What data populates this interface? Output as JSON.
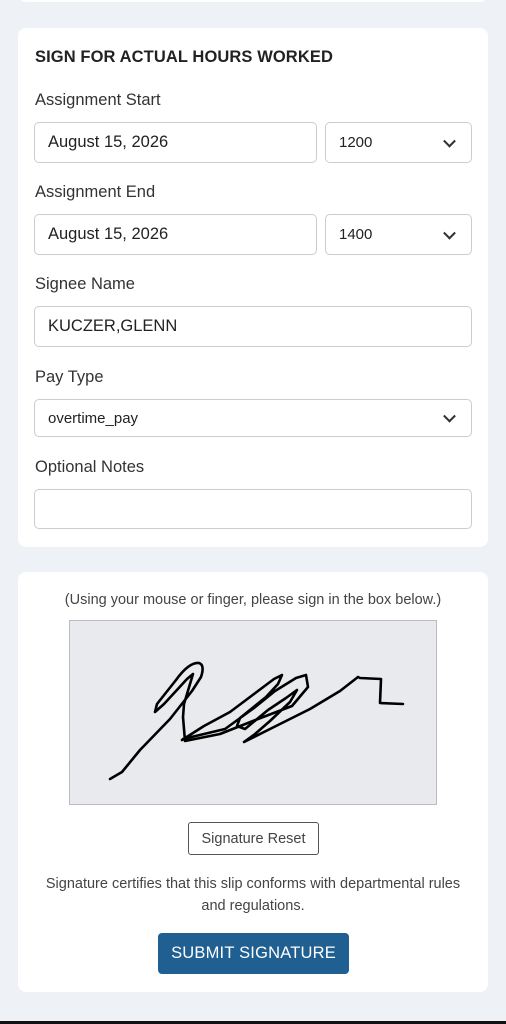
{
  "form": {
    "title": "SIGN FOR ACTUAL HOURS WORKED",
    "assignment_start": {
      "label": "Assignment Start",
      "date": "August 15, 2026",
      "time": "1200"
    },
    "assignment_end": {
      "label": "Assignment End",
      "date": "August 15, 2026",
      "time": "1400"
    },
    "signee": {
      "label": "Signee Name",
      "value": "KUCZER,GLENN"
    },
    "pay_type": {
      "label": "Pay Type",
      "value": "overtime_pay"
    },
    "notes": {
      "label": "Optional Notes",
      "value": ""
    }
  },
  "signature": {
    "instructions": "(Using your mouse or finger, please sign in the box below.)",
    "reset_label": "Signature Reset",
    "certify_text": "Signature certifies that this slip conforms with departmental rules and regulations.",
    "submit_label": "SUBMIT SIGNATURE"
  },
  "colors": {
    "background": "#eef1f5",
    "card": "#ffffff",
    "primary_button": "#1f5f91",
    "signature_pad": "#e9eaed"
  }
}
